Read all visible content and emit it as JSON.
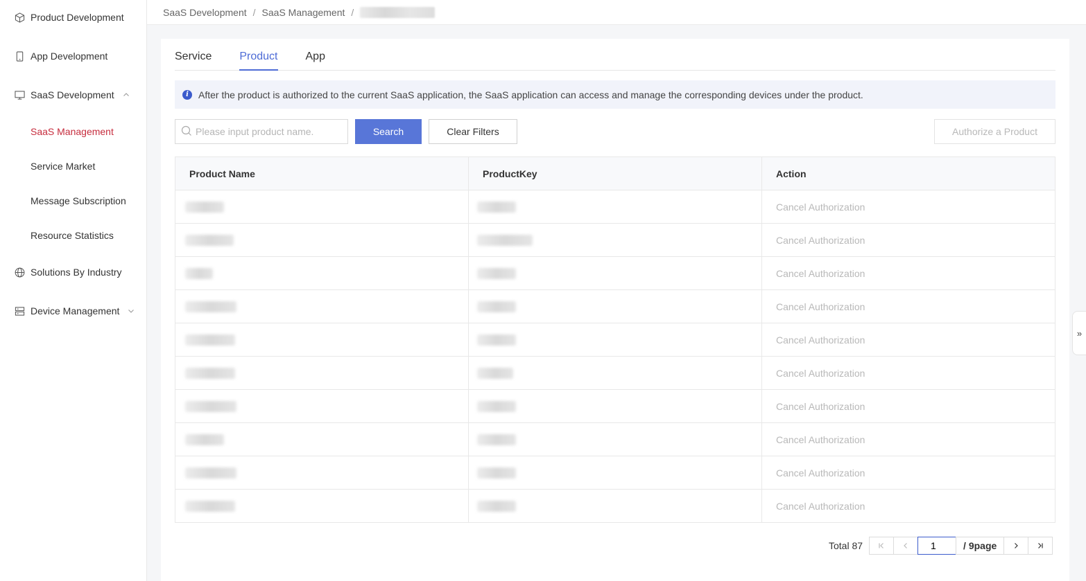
{
  "sidebar": {
    "items": [
      {
        "label": "Product Development",
        "icon": "cube-icon"
      },
      {
        "label": "App Development",
        "icon": "phone-icon"
      },
      {
        "label": "SaaS Development",
        "icon": "monitor-icon",
        "expanded": true,
        "children": [
          "SaaS Management",
          "Service Market",
          "Message Subscription",
          "Resource Statistics"
        ]
      },
      {
        "label": "Solutions By Industry",
        "icon": "globe-icon"
      },
      {
        "label": "Device Management",
        "icon": "server-icon",
        "expanded": false
      }
    ],
    "active_child": "SaaS Management"
  },
  "breadcrumb": {
    "items": [
      "SaaS Development",
      "SaaS Management"
    ],
    "separator": "/"
  },
  "tabs": [
    "Service",
    "Product",
    "App"
  ],
  "active_tab": "Product",
  "notice": "After the product is authorized to the current SaaS application, the SaaS application can access and manage the corresponding devices under the product.",
  "search": {
    "placeholder": "Please input product name.",
    "search_label": "Search",
    "clear_label": "Clear Filters",
    "authorize_label": "Authorize a Product"
  },
  "table": {
    "headers": [
      "Product Name",
      "ProductKey",
      "Action"
    ],
    "action_label": "Cancel Authorization",
    "row_count": 10
  },
  "pagination": {
    "total_text": "Total 87",
    "current_page": "1",
    "pages_text": "/ 9page"
  },
  "colors": {
    "accent": "#5876d8",
    "active_menu": "#c62c3d",
    "tab_active": "#4d6bd6"
  }
}
